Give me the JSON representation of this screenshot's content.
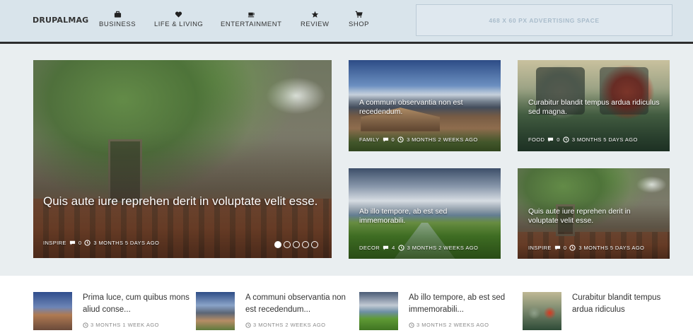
{
  "logo": {
    "bold": "DRUPAL",
    "rest": "MAG"
  },
  "nav": [
    {
      "label": "BUSINESS",
      "icon": "briefcase-icon"
    },
    {
      "label": "LIFE & LIVING",
      "icon": "heart-icon"
    },
    {
      "label": "ENTERTAINMENT",
      "icon": "coffee-icon"
    },
    {
      "label": "REVIEW",
      "icon": "star-icon"
    },
    {
      "label": "SHOP",
      "icon": "cart-icon"
    }
  ],
  "ad": {
    "text": "468 X 60 PX ADVERTISING SPACE"
  },
  "featured": {
    "title": "Quis aute iure reprehen derit in voluptate velit esse.",
    "category": "INSPIRE",
    "comments": "0",
    "date": "3 MONTHS 5 DAYS AGO",
    "slides": 5,
    "active_slide": 1
  },
  "tiles": [
    {
      "title": "A communi observantia non est recedendum.",
      "category": "FAMILY",
      "comments": "0",
      "date": "3 MONTHS 2 WEEKS AGO"
    },
    {
      "title": "Curabitur blandit tempus ardua ridiculus sed magna.",
      "category": "FOOD",
      "comments": "0",
      "date": "3 MONTHS 5 DAYS AGO"
    },
    {
      "title": "Ab illo tempore, ab est sed immemorabili.",
      "category": "DECOR",
      "comments": "4",
      "date": "3 MONTHS 2 WEEKS AGO"
    },
    {
      "title": "Quis aute iure reprehen derit in voluptate velit esse.",
      "category": "INSPIRE",
      "comments": "0",
      "date": "3 MONTHS 5 DAYS AGO"
    }
  ],
  "list": [
    {
      "title": "Prima luce, cum quibus mons aliud conse...",
      "date": "3 MONTHS 1 WEEK AGO"
    },
    {
      "title": "A communi observantia non est recedendum...",
      "date": "3 MONTHS 2 WEEKS AGO"
    },
    {
      "title": "Ab illo tempore, ab est sed immemorabili...",
      "date": "3 MONTHS 2 WEEKS AGO"
    },
    {
      "title": "Curabitur blandit tempus ardua ridiculus",
      "date": ""
    }
  ],
  "colors": {
    "header": "#d9e4eb",
    "header_bar": "#2d2d2d",
    "page": "#e9eef0",
    "ad_text": "#a9bccb"
  }
}
